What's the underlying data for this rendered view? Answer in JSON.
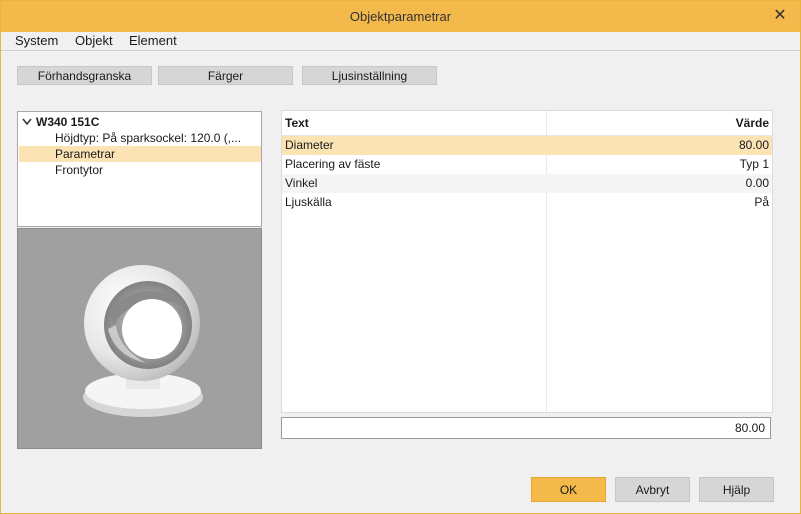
{
  "window": {
    "title": "Objektparametrar",
    "close_glyph": "✕"
  },
  "menu": [
    "System",
    "Objekt",
    "Element"
  ],
  "toolbar": {
    "preview_label": "Förhandsgranska",
    "colors_label": "Färger",
    "light_label": "Ljusinställning"
  },
  "tree": {
    "root_label": "W340 151C",
    "items": [
      "Höjdtyp: På sparksockel:  120.0 (,...",
      "Parametrar",
      "Frontytor"
    ]
  },
  "grid": {
    "col_text": "Text",
    "col_value": "Värde",
    "rows": [
      {
        "text": "Diameter",
        "value": "80.00"
      },
      {
        "text": "Placering av fäste",
        "value": "Typ 1"
      },
      {
        "text": "Vinkel",
        "value": "0.00"
      },
      {
        "text": "Ljuskälla",
        "value": "På"
      }
    ]
  },
  "value_field": "80.00",
  "buttons": {
    "ok": "OK",
    "cancel": "Avbryt",
    "help": "Hjälp"
  },
  "colors": {
    "accent": "#f3b94b",
    "selected_row": "#fbe3b4",
    "alt_row": "#f5f5f5"
  }
}
